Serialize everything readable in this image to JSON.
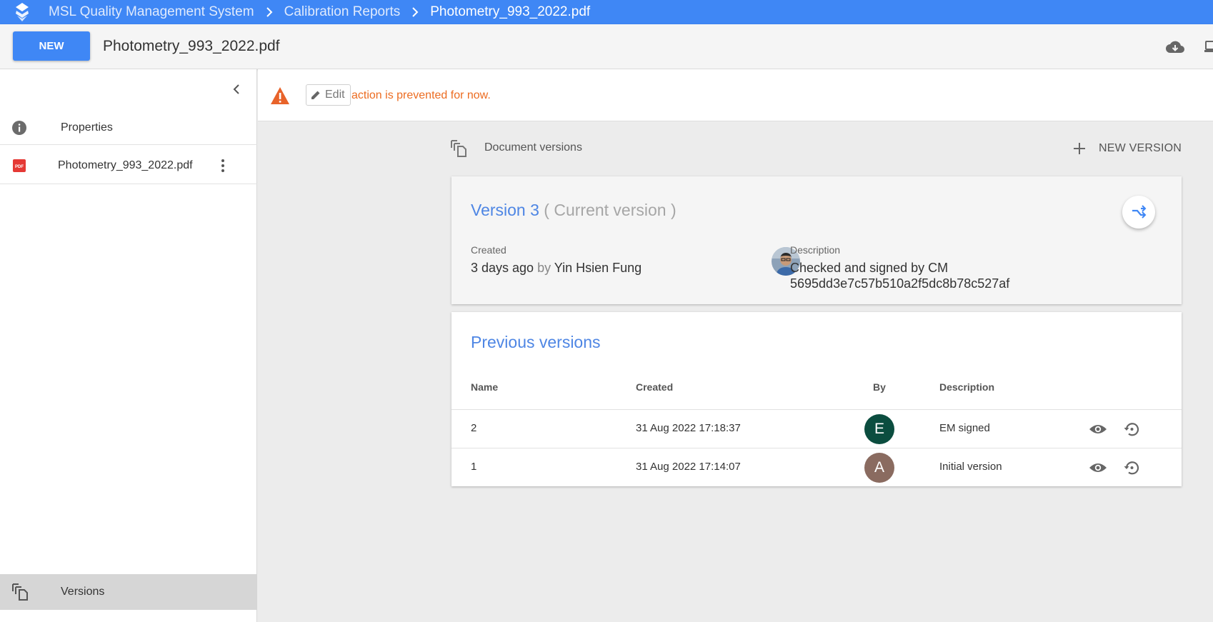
{
  "breadcrumb": {
    "items": [
      "MSL Quality Management System",
      "Calibration Reports",
      "Photometry_993_2022.pdf"
    ]
  },
  "toolbar": {
    "new_label": "NEW",
    "file_title": "Photometry_993_2022.pdf",
    "icons": [
      "cloud-download-icon"
    ]
  },
  "sidebar": {
    "properties_label": "Properties",
    "file_label": "Photometry_993_2022.pdf",
    "versions_label": "Versions"
  },
  "banner": {
    "edit_label": "Edit",
    "message": "action is prevented for now."
  },
  "document_versions": {
    "title": "Document versions",
    "new_version_label": "NEW VERSION"
  },
  "current_version": {
    "title": "Version 3",
    "subtitle": "( Current version )",
    "created_label": "Created",
    "created_value": "3 days ago",
    "by_word": "by",
    "author": "Yin Hsien Fung",
    "description_label": "Description",
    "description_line1": "Checked and signed by CM",
    "description_line2": "5695dd3e7c57b510a2f5dc8b78c527af"
  },
  "previous_versions": {
    "title": "Previous versions",
    "columns": [
      "Name",
      "Created",
      "By",
      "Description"
    ],
    "rows": [
      {
        "name": "2",
        "created": "31 Aug 2022 17:18:37",
        "by_initial": "E",
        "by_color": "#0b4d3f",
        "description": "EM signed"
      },
      {
        "name": "1",
        "created": "31 Aug 2022 17:14:07",
        "by_initial": "A",
        "by_color": "#8a6b60",
        "description": "Initial version"
      }
    ]
  },
  "colors": {
    "primary": "#3f87f5",
    "link_blue": "#4e86e4",
    "warning": "#ec6c21"
  }
}
